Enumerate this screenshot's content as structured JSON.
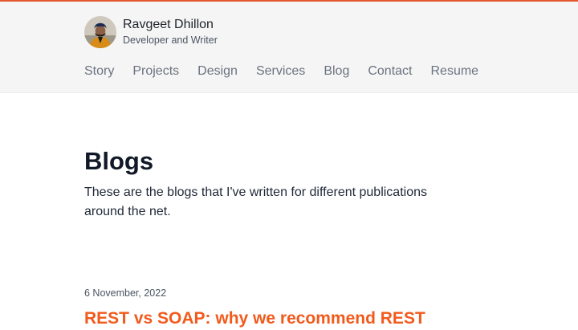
{
  "colors": {
    "accent": "#e4572e",
    "link": "#f25a1c",
    "header_bg": "#f5f5f5"
  },
  "header": {
    "name": "Ravgeet Dhillon",
    "tagline": "Developer and Writer",
    "avatar_icon": "profile-photo"
  },
  "nav": {
    "items": [
      {
        "label": "Story"
      },
      {
        "label": "Projects"
      },
      {
        "label": "Design"
      },
      {
        "label": "Services"
      },
      {
        "label": "Blog"
      },
      {
        "label": "Contact"
      },
      {
        "label": "Resume"
      }
    ]
  },
  "main": {
    "title": "Blogs",
    "intro": "These are the blogs that I've written for different publications around the net."
  },
  "posts": [
    {
      "date": "6 November, 2022",
      "title": "REST vs SOAP: why we recommend REST"
    }
  ]
}
